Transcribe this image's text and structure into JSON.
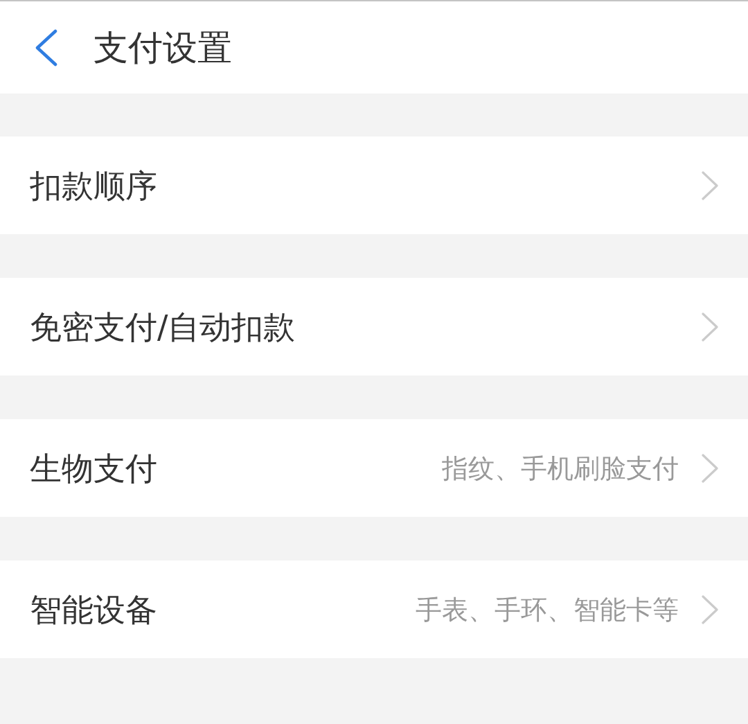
{
  "header": {
    "title": "支付设置"
  },
  "settings": [
    {
      "label": "扣款顺序"
    },
    {
      "label": "免密支付/自动扣款"
    },
    {
      "label": "生物支付",
      "value": "指纹、手机刷脸支付"
    },
    {
      "label": "智能设备",
      "value": "手表、手环、智能卡等"
    }
  ]
}
